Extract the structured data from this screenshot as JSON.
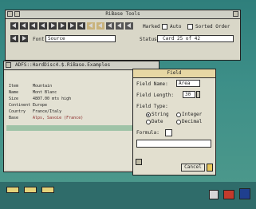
{
  "tools_window": {
    "title": "RiBase Tools",
    "fonts_label": "Font",
    "font_value": "Source",
    "marked_label": "Marked",
    "auto_label": "Auto",
    "sorted_label": "Sorted Order",
    "status_label": "Status",
    "status_value": "Card 25 of 42"
  },
  "record_window": {
    "title": "ADFS::HardDisc4.$.RiBase.Examples",
    "fields": [
      {
        "name": "Item",
        "value": "Mountain"
      },
      {
        "name": "Name",
        "value": "Mont Blanc"
      },
      {
        "name": "Size",
        "value": "4807.00 mts high"
      },
      {
        "name": "Continent",
        "value": "Europe"
      },
      {
        "name": "Country",
        "value": "France/Italy"
      },
      {
        "name": "Base",
        "value": "Alps, Savoie (France)"
      }
    ]
  },
  "field_dialog": {
    "title": "Field",
    "name_label": "Field Name:",
    "name_value": "Area",
    "length_label": "Field Length:",
    "length_value": "30",
    "type_label": "Field Type:",
    "types": [
      {
        "label": "String",
        "selected": true
      },
      {
        "label": "Integer",
        "selected": false
      },
      {
        "label": "Date",
        "selected": false
      },
      {
        "label": "Decimal",
        "selected": false
      }
    ],
    "formula_label": "Formula:",
    "cancel_label": "Cancel"
  },
  "iconbar": {
    "left_labels": [
      "",
      "",
      ""
    ],
    "right_icons": [
      "disc-icon",
      "printer-icon",
      "app-icon"
    ]
  },
  "colors": {
    "desktop": "#3c8a86",
    "window": "#d9d7c8",
    "selection": "#9fc3a7",
    "active_title": "#e7d7a4"
  }
}
